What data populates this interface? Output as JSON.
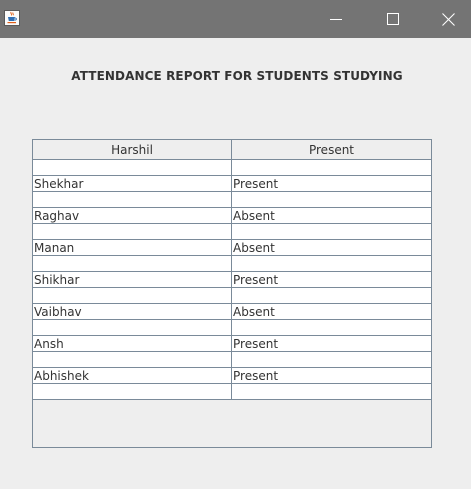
{
  "window": {
    "icon": "java-cup-icon",
    "controls": [
      "minimize-icon",
      "maximize-icon",
      "close-icon"
    ]
  },
  "heading": "ATTENDANCE REPORT FOR STUDENTS STUDYING",
  "table": {
    "columns": [
      "Harshil",
      "Present"
    ],
    "rows": [
      [
        "",
        ""
      ],
      [
        "Shekhar",
        "Present"
      ],
      [
        "",
        ""
      ],
      [
        "Raghav",
        "Absent"
      ],
      [
        "",
        ""
      ],
      [
        "Manan",
        "Absent"
      ],
      [
        "",
        ""
      ],
      [
        "Shikhar",
        "Present"
      ],
      [
        "",
        ""
      ],
      [
        "Vaibhav",
        "Absent"
      ],
      [
        "",
        ""
      ],
      [
        "Ansh",
        "Present"
      ],
      [
        "",
        ""
      ],
      [
        "Abhishek",
        "Present"
      ],
      [
        "",
        ""
      ]
    ]
  }
}
